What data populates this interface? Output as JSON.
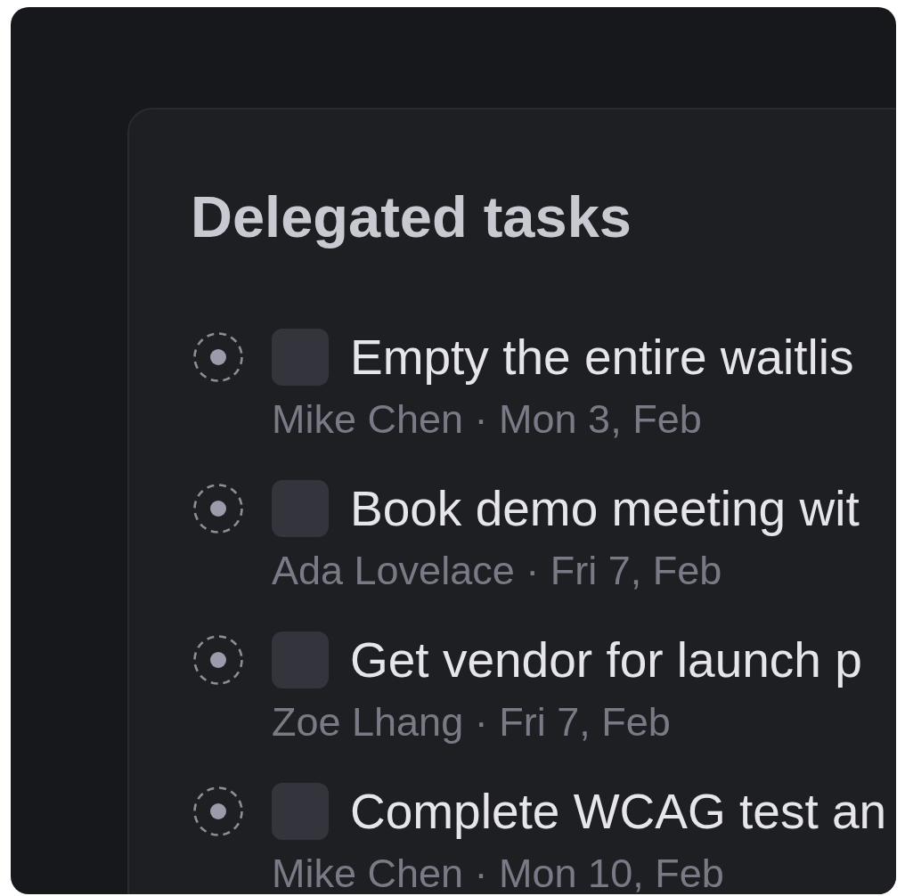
{
  "card": {
    "title": "Delegated tasks"
  },
  "tasks": [
    {
      "title": "Empty the entire waitlis",
      "meta": "Mike Chen · Mon 3, Feb",
      "checked": false
    },
    {
      "title": "Book demo meeting wit",
      "meta": "Ada Lovelace · Fri 7, Feb",
      "checked": false
    },
    {
      "title": "Get vendor for launch p",
      "meta": "Zoe Lhang · Fri 7, Feb",
      "checked": false
    },
    {
      "title": "Complete WCAG test an",
      "meta": "Mike Chen · Mon 10, Feb",
      "checked": false
    }
  ]
}
